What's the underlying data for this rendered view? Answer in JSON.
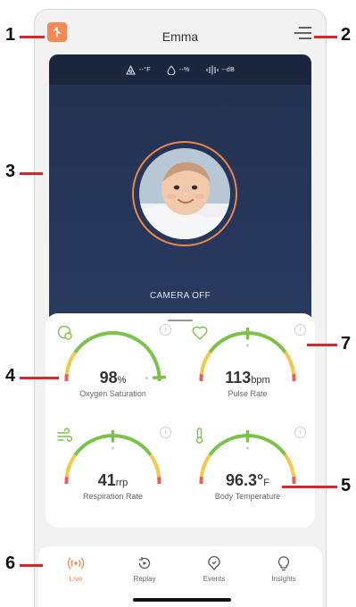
{
  "header": {
    "title": "Emma"
  },
  "sensors": [
    {
      "icon": "temperature-icon",
      "value": "--°F"
    },
    {
      "icon": "humidity-icon",
      "value": "--%"
    },
    {
      "icon": "sound-level-icon",
      "value": "--dB"
    }
  ],
  "camera": {
    "status": "CAMERA OFF"
  },
  "metrics": {
    "oxygen": {
      "value": "98",
      "unit": "%",
      "label": "Oxygen Saturation",
      "level": 0.92
    },
    "pulse": {
      "value": "113",
      "unit": "bpm",
      "label": "Pulse Rate",
      "level": 0.5
    },
    "respiration": {
      "value": "41",
      "unit": "rrp",
      "label": "Respiration Rate",
      "level": 0.5
    },
    "temperature": {
      "value": "96.3°",
      "unit": "F",
      "label": "Body Temperature",
      "level": 0.5
    }
  },
  "info_glyph": "i",
  "nav": [
    {
      "label": "Live",
      "active": true
    },
    {
      "label": "Replay",
      "active": false
    },
    {
      "label": "Events",
      "active": false
    },
    {
      "label": "Insights",
      "active": false
    }
  ],
  "callouts": [
    "1",
    "2",
    "3",
    "4",
    "5",
    "6",
    "7"
  ],
  "colors": {
    "accent": "#f28a52",
    "gauge_green": "#7cc24a",
    "gauge_yellow": "#f2c94c",
    "gauge_red": "#e8605a",
    "leader": "#d8262d"
  }
}
